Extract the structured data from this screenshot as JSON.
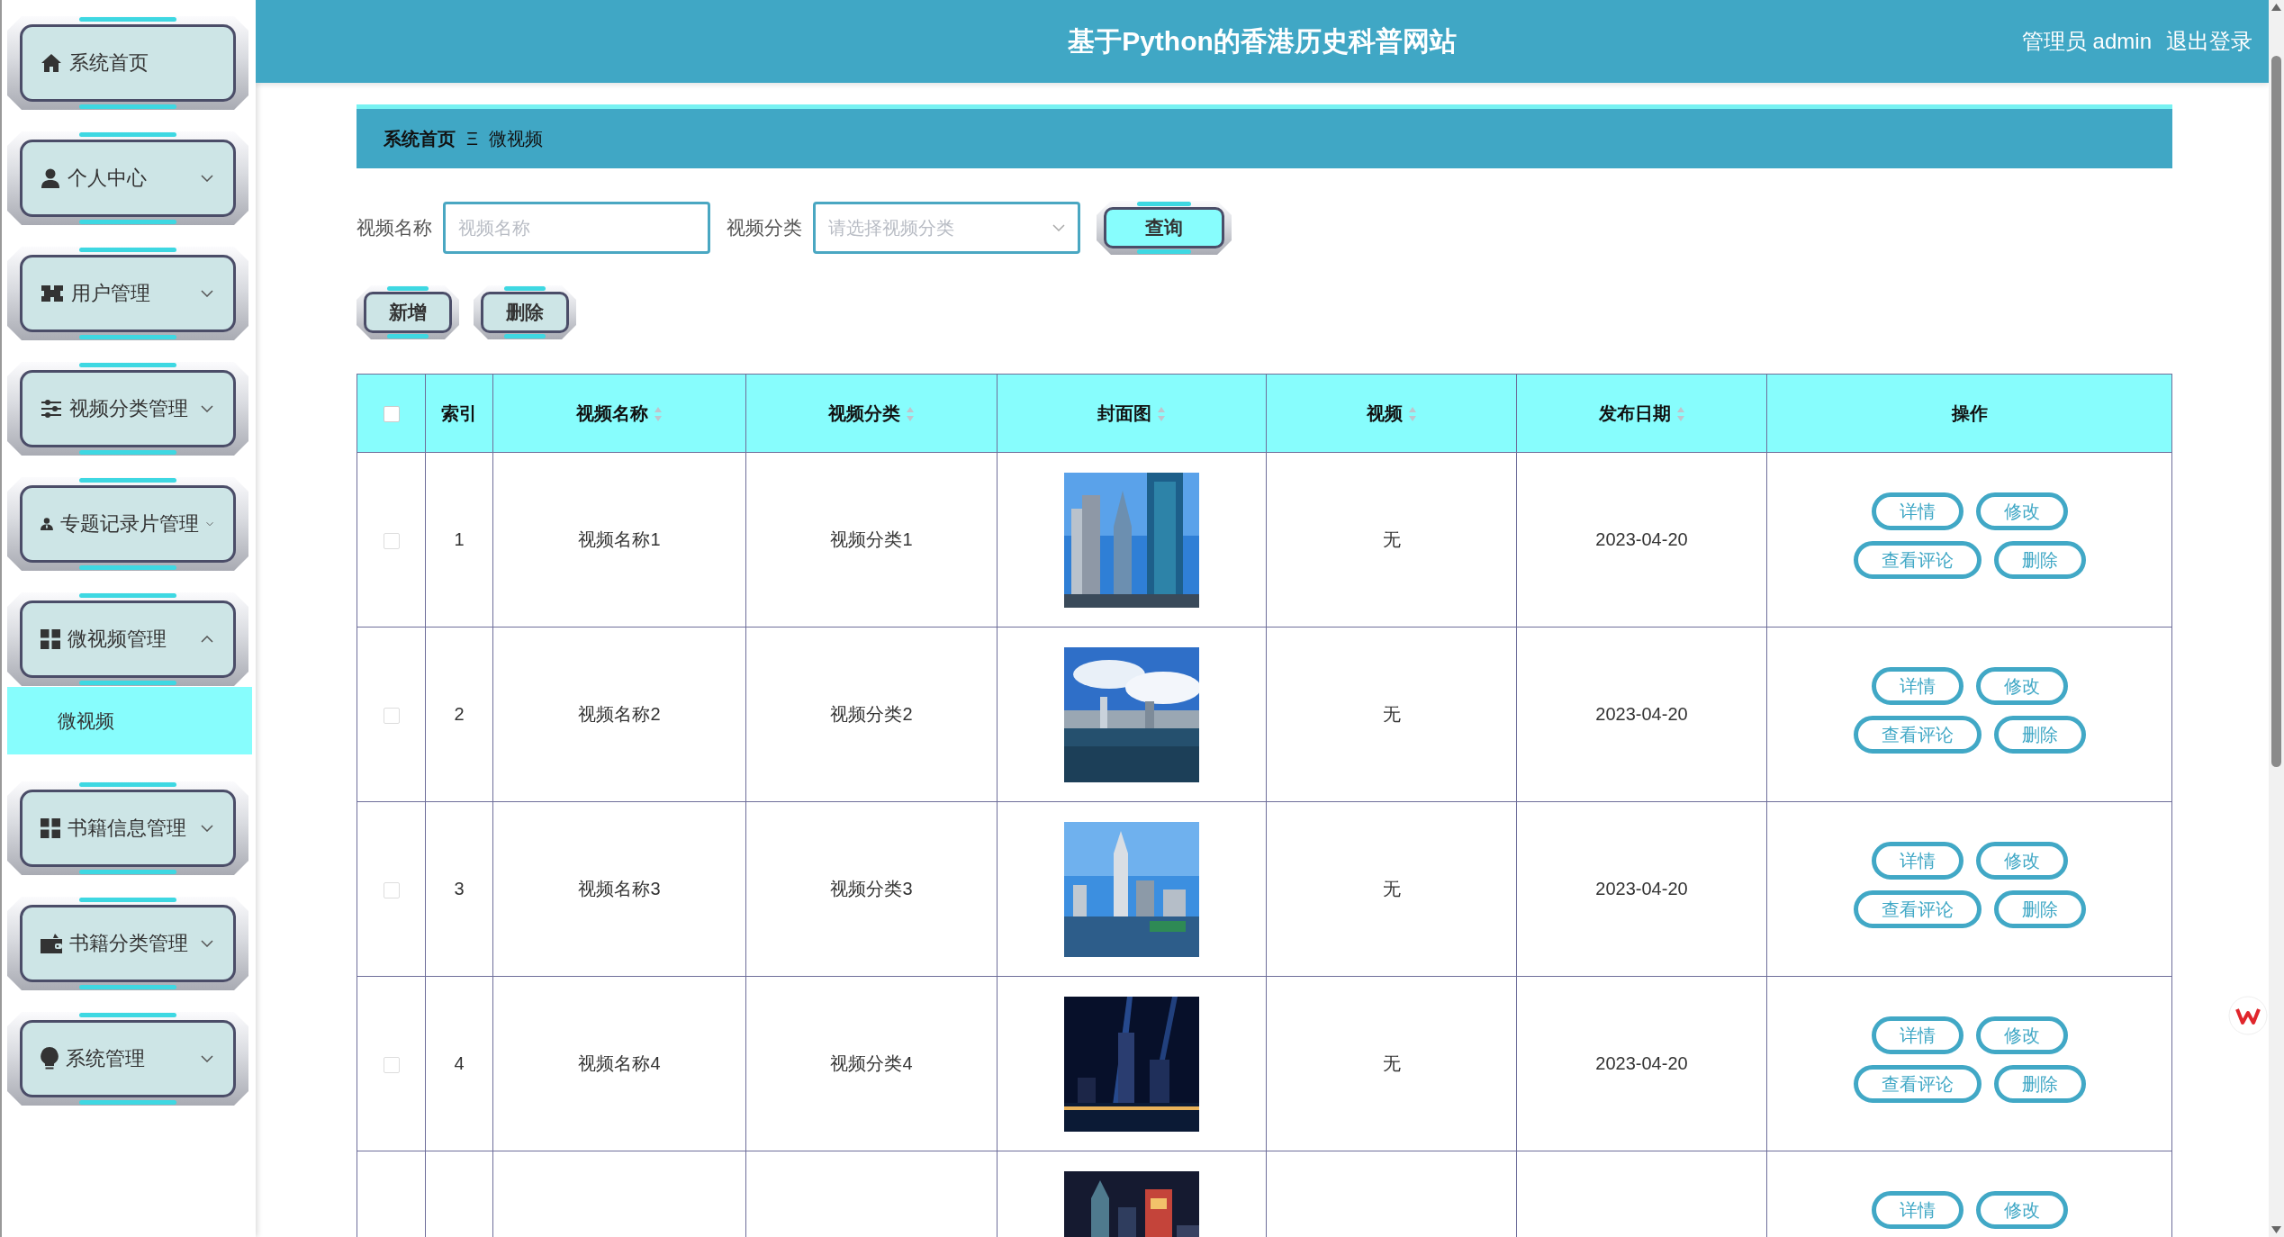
{
  "sidebar": {
    "items": [
      {
        "kind": "link",
        "label": "系统首页"
      },
      {
        "kind": "group",
        "label": "个人中心",
        "expanded": false
      },
      {
        "kind": "group",
        "label": "用户管理",
        "expanded": false
      },
      {
        "kind": "group",
        "label": "视频分类管理",
        "expanded": false
      },
      {
        "kind": "group",
        "label": "专题记录片管理",
        "expanded": false
      },
      {
        "kind": "group",
        "label": "微视频管理",
        "expanded": true,
        "children": [
          {
            "label": "微视频",
            "selected": true
          }
        ]
      },
      {
        "kind": "group",
        "label": "书籍信息管理",
        "expanded": false
      },
      {
        "kind": "group",
        "label": "书籍分类管理",
        "expanded": false
      },
      {
        "kind": "group",
        "label": "系统管理",
        "expanded": false
      }
    ]
  },
  "header": {
    "title": "基于Python的香港历史科普网站",
    "user": "管理员 admin",
    "logout": "退出登录"
  },
  "breadcrumb": {
    "items": [
      "系统首页",
      "微视频"
    ],
    "separator": "Ξ"
  },
  "search": {
    "fields": [
      {
        "kind": "text",
        "label": "视频名称",
        "placeholder": "视频名称"
      },
      {
        "kind": "select",
        "label": "视频分类",
        "placeholder": "请选择视频分类"
      }
    ],
    "button": "查询"
  },
  "actions": [
    "新增",
    "删除"
  ],
  "table": {
    "columns": [
      {
        "kind": "checkbox",
        "checked": false
      },
      {
        "kind": "text",
        "label": "索引",
        "sortable": false
      },
      {
        "kind": "text",
        "label": "视频名称",
        "sortable": true
      },
      {
        "kind": "text",
        "label": "视频分类",
        "sortable": true
      },
      {
        "kind": "text",
        "label": "封面图",
        "sortable": true
      },
      {
        "kind": "text",
        "label": "视频",
        "sortable": true
      },
      {
        "kind": "text",
        "label": "发布日期",
        "sortable": true
      },
      {
        "kind": "text",
        "label": "操作",
        "sortable": false
      }
    ],
    "rows": [
      {
        "checked": false,
        "index": "1",
        "name": "视频名称1",
        "category": "视频分类1",
        "cover": {
          "kind": "picture"
        },
        "video": "无",
        "date": "2023-04-20",
        "actions": [
          "详情",
          "修改",
          "查看评论",
          "删除"
        ]
      },
      {
        "checked": false,
        "index": "2",
        "name": "视频名称2",
        "category": "视频分类2",
        "cover": {
          "kind": "picture"
        },
        "video": "无",
        "date": "2023-04-20",
        "actions": [
          "详情",
          "修改",
          "查看评论",
          "删除"
        ]
      },
      {
        "checked": false,
        "index": "3",
        "name": "视频名称3",
        "category": "视频分类3",
        "cover": {
          "kind": "picture"
        },
        "video": "无",
        "date": "2023-04-20",
        "actions": [
          "详情",
          "修改",
          "查看评论",
          "删除"
        ]
      },
      {
        "checked": false,
        "index": "4",
        "name": "视频名称4",
        "category": "视频分类4",
        "cover": {
          "kind": "picture"
        },
        "video": "无",
        "date": "2023-04-20",
        "actions": [
          "详情",
          "修改",
          "查看评论",
          "删除"
        ]
      },
      {
        "cover": {
          "kind": "picture"
        },
        "actions": [
          "详情",
          "修改"
        ]
      }
    ]
  }
}
